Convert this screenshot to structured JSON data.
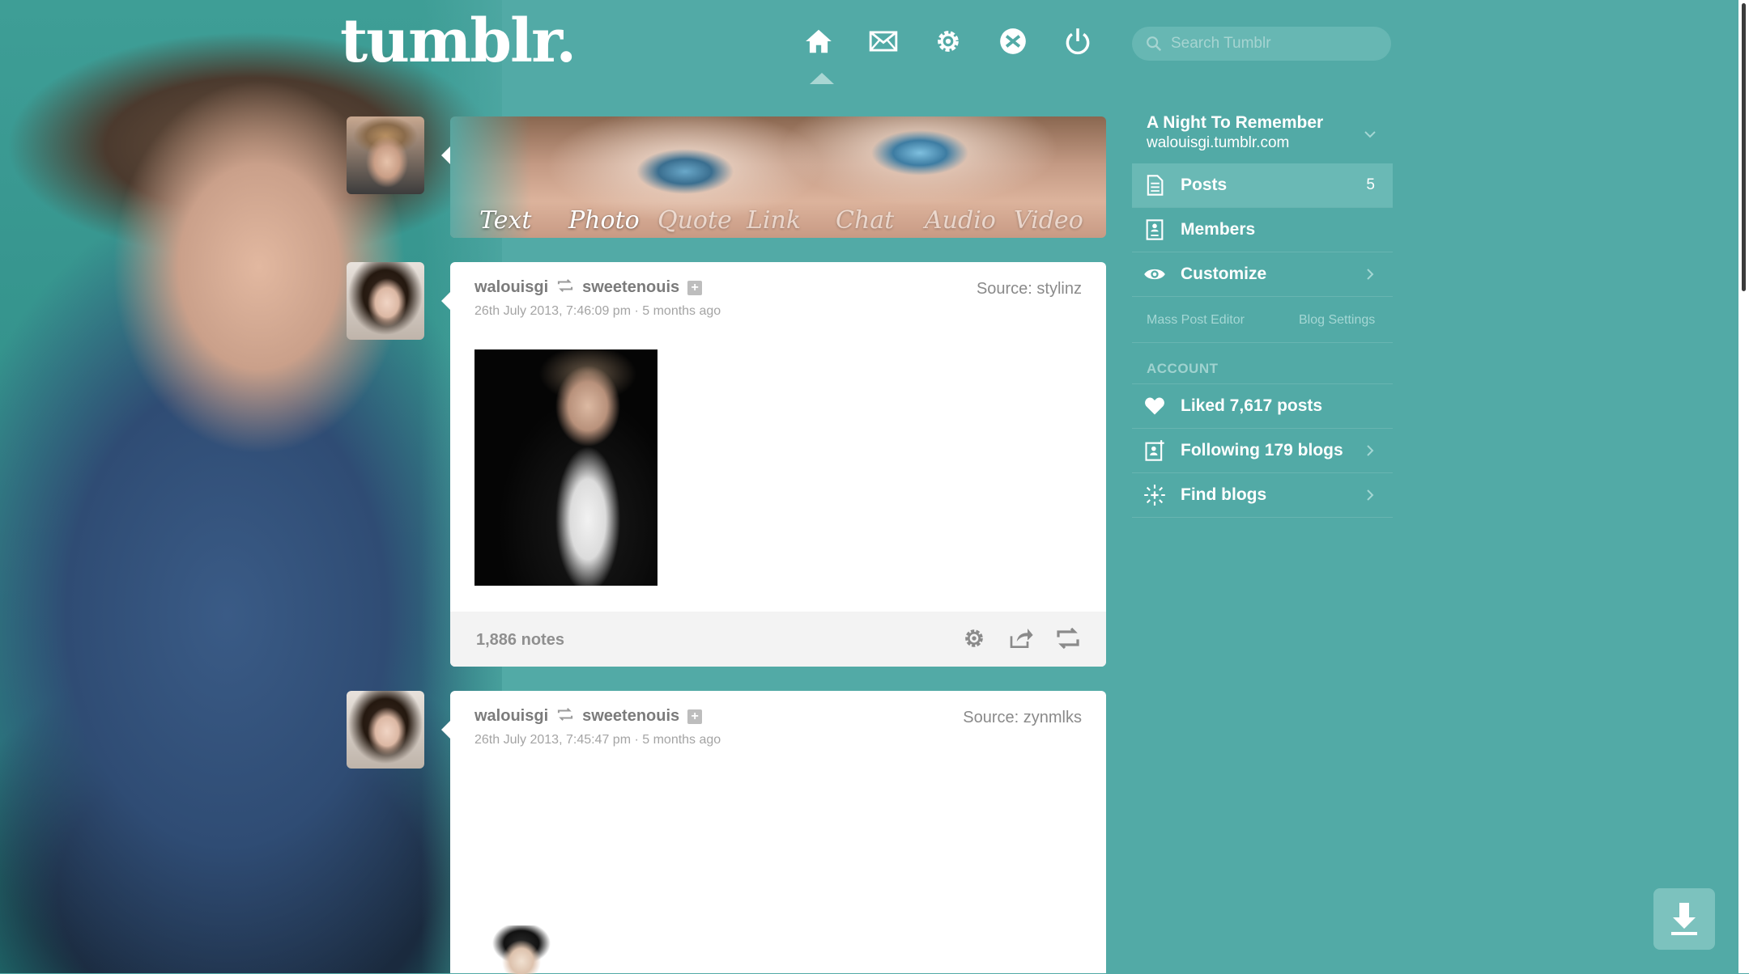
{
  "header": {
    "logo": "tumblr.",
    "nav_icons": [
      "home-icon",
      "mail-icon",
      "gear-icon",
      "xkit-icon",
      "power-icon"
    ],
    "search_placeholder": "Search Tumblr"
  },
  "post_types": [
    "Text",
    "Photo",
    "Quote",
    "Link",
    "Chat",
    "Audio",
    "Video"
  ],
  "posts": [
    {
      "author": "walouisgi",
      "reblogged_from": "sweetenouis",
      "date": "26th July 2013, 7:46:09 pm · 5 months ago",
      "source": "Source: stylinz",
      "notes": "1,886 notes"
    },
    {
      "author": "walouisgi",
      "reblogged_from": "sweetenouis",
      "date": "26th July 2013, 7:45:47 pm · 5 months ago",
      "source": "Source: zynmlks"
    }
  ],
  "sidebar": {
    "blog_title": "A Night To Remember",
    "blog_url": "walouisgi.tumblr.com",
    "items": [
      {
        "label": "Posts",
        "count": "5",
        "icon": "posts-icon"
      },
      {
        "label": "Members",
        "icon": "members-icon"
      },
      {
        "label": "Customize",
        "icon": "eye-icon"
      }
    ],
    "links": [
      "Mass Post Editor",
      "Blog Settings"
    ],
    "account_heading": "ACCOUNT",
    "account_items": [
      {
        "label": "Liked 7,617 posts",
        "icon": "heart-icon"
      },
      {
        "label": "Following 179 blogs",
        "icon": "following-icon"
      },
      {
        "label": "Find blogs",
        "icon": "find-blogs-icon"
      }
    ]
  },
  "colors": {
    "background": "#52aaa6",
    "card": "#ffffff",
    "accent_active": "#6ab9b5"
  }
}
